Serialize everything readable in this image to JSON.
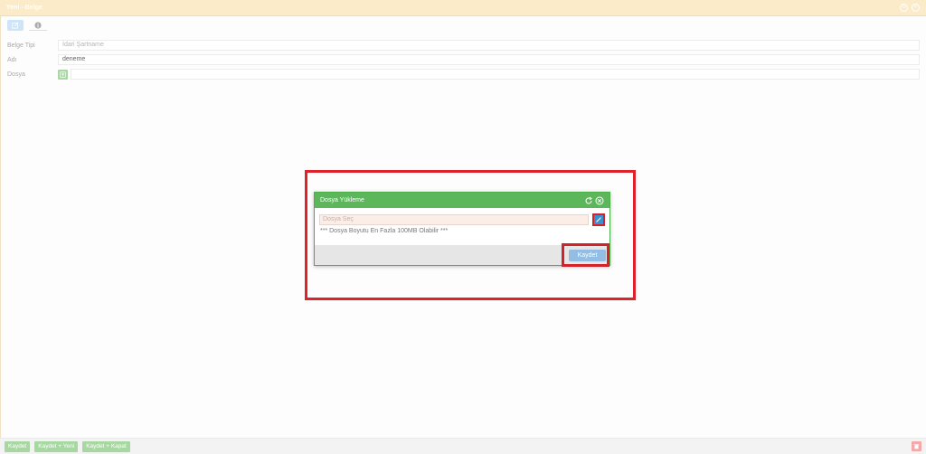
{
  "window": {
    "title": "Yeni - Belge"
  },
  "tabs": [
    {
      "icon": "edit-icon",
      "active": true
    },
    {
      "icon": "info-icon",
      "active": false
    }
  ],
  "form": {
    "belge_tipi": {
      "label": "Belge Tipi",
      "value": "İdari Şartname"
    },
    "adi": {
      "label": "Adı",
      "value": "deneme"
    },
    "dosya": {
      "label": "Dosya"
    }
  },
  "dialog": {
    "title": "Dosya Yükleme",
    "file_placeholder": "Dosya Seç",
    "note": "*** Dosya Boyutu En Fazla 100MB Olabilir ***",
    "save_label": "Kaydet"
  },
  "bottom_bar": {
    "save": "Kaydet",
    "save_new": "Kaydet + Yeni",
    "save_close": "Kaydet + Kapat"
  },
  "colors": {
    "header_bg": "#fcebc8",
    "dialog_header": "#5bb75a",
    "highlight": "#e0232a",
    "primary": "#3a8fd0"
  }
}
